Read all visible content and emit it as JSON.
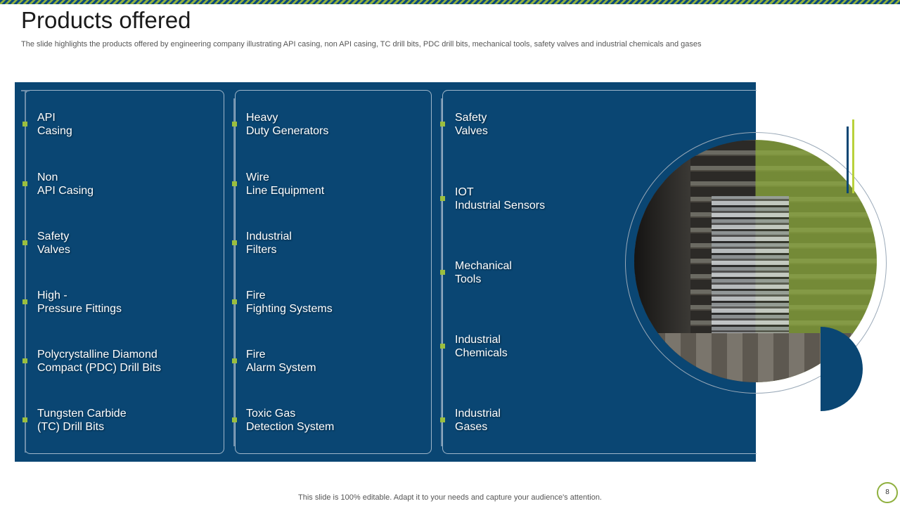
{
  "slide": {
    "title": "Products offered",
    "subtitle": "The slide highlights the products offered by engineering company illustrating API casing, non API casing, TC drill bits, PDC drill bits, mechanical tools, safety valves and industrial chemicals and gases",
    "footer": "This slide is 100% editable. Adapt it to your needs and capture your audience's attention.",
    "page_number": "8"
  },
  "columns": [
    {
      "items": [
        {
          "line1": "API",
          "line2": "Casing"
        },
        {
          "line1": "Non",
          "line2": "API Casing"
        },
        {
          "line1": "Safety",
          "line2": "Valves"
        },
        {
          "line1": "High -",
          "line2": "Pressure Fittings"
        },
        {
          "line1": "Polycrystalline  Diamond",
          "line2": "Compact (PDC) Drill Bits"
        },
        {
          "line1": "Tungsten  Carbide",
          "line2": "(TC) Drill Bits"
        }
      ]
    },
    {
      "items": [
        {
          "line1": "Heavy",
          "line2": "Duty Generators"
        },
        {
          "line1": "Wire",
          "line2": "Line Equipment"
        },
        {
          "line1": "Industrial",
          "line2": "Filters"
        },
        {
          "line1": "Fire",
          "line2": "Fighting Systems"
        },
        {
          "line1": "Fire",
          "line2": "Alarm System"
        },
        {
          "line1": "Toxic Gas",
          "line2": "Detection System"
        }
      ]
    },
    {
      "items": [
        {
          "line1": "Safety",
          "line2": "Valves"
        },
        {
          "line1": "IOT",
          "line2": "Industrial  Sensors"
        },
        {
          "line1": "Mechanical",
          "line2": "Tools"
        },
        {
          "line1": "Industrial",
          "line2": "Chemicals"
        },
        {
          "line1": "Industrial",
          "line2": "Gases"
        }
      ]
    }
  ],
  "colors": {
    "panel": "#0a4673",
    "accent": "#8fb03e",
    "bullet": "#9bbf3f"
  }
}
